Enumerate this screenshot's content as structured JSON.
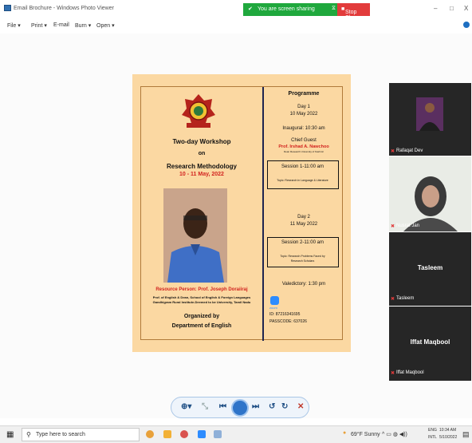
{
  "window": {
    "title": "Email Brochure - Windows Photo Viewer",
    "controls": [
      "–",
      "□",
      "X"
    ]
  },
  "share_banner": {
    "text": "You are screen sharing",
    "stop_label": "Stop Share",
    "color": "#1fa83d",
    "stop_color": "#e23b3b"
  },
  "menu": {
    "items": [
      "File ▾",
      "Print ▾",
      "E-mail",
      "Burn ▾",
      "Open ▾"
    ]
  },
  "poster": {
    "left": {
      "title_line1": "Two-day Workshop",
      "title_line2": "on",
      "title_line3": "Research Methodology",
      "dates": "10 - 11 May, 2022",
      "resource_person": "Resource Person: Prof. Joseph Doraiiraj",
      "affiliation_line1": "Prof. of English & Dean, School of English & Foreign Languages",
      "affiliation_line2": "Gandhigram Rural Institute-Deemed to be University, Tamil Nadu",
      "organized_by": "Organized by",
      "department": "Department of English"
    },
    "right": {
      "programme": "Programme",
      "day1": "Day 1",
      "day1_date": "10 May 2022",
      "inaugural": "Inaugural: 10:30 am",
      "chief_guest": "Chief Guest",
      "guest_name": "Prof. Irshad A. Nawchoo",
      "guest_role": "Dean Research University of Kashmir",
      "session1": "Session 1-11:00 am",
      "topic1": "Topic: Research in Language & Literature",
      "day2": "Day 2",
      "day2_date": "11 May 2022",
      "session2": "Session 2-11:00 am",
      "topic2_line1": "Topic: Research Problems Faced by",
      "topic2_line2": "Research Scholars",
      "valedictory": "Valedictory: 1:30 pm",
      "zoom": "zoom",
      "zoom_id": "ID: 87216341695",
      "passcode": "PASSCODE: 637026"
    },
    "bg_color": "#fbd8a2",
    "accent_red": "#d2231f"
  },
  "participants": [
    {
      "name": "Rafaqat Dev",
      "big": ""
    },
    {
      "name": "Nusrat Jan",
      "big": ""
    },
    {
      "name": "Tasleem",
      "big": "Tasleem"
    },
    {
      "name": "Iffat Maqbool",
      "big": "Iffat Maqbool"
    }
  ],
  "taskbar": {
    "search_placeholder": "Type here to search",
    "weather": "69°F  Sunny",
    "lang1": "ENG",
    "lang2": "INTL",
    "time": "10:34 AM",
    "date": "5/10/2022"
  }
}
